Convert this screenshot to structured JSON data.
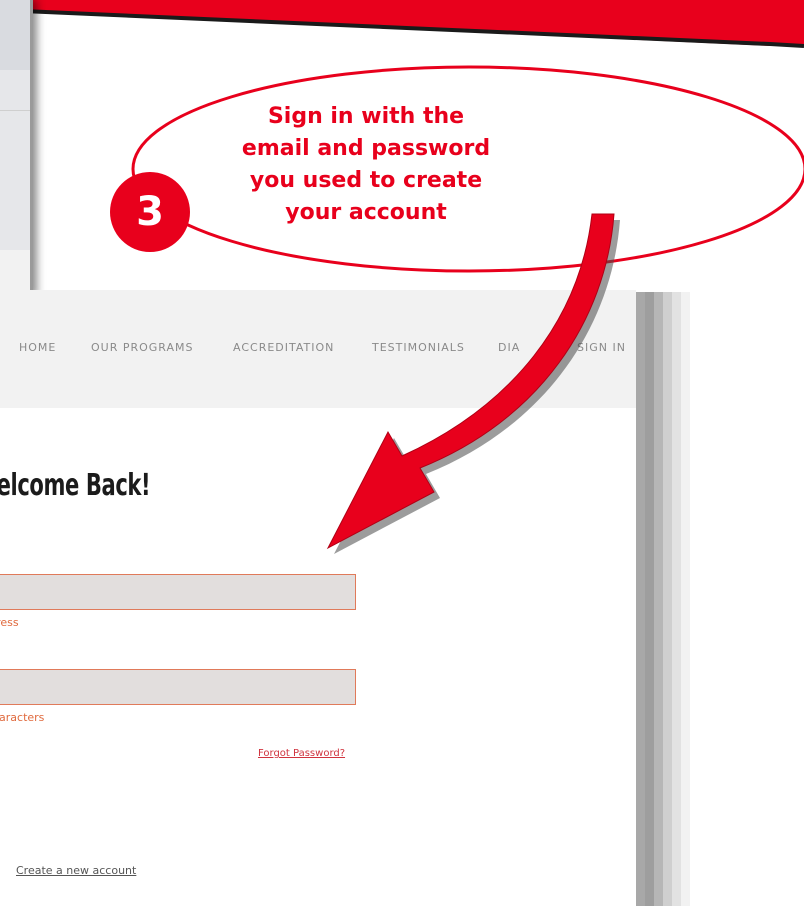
{
  "callout": {
    "text": "Sign in with the email and password you used to create your account",
    "step_number": "3",
    "accent_color": "#e8001c"
  },
  "site": {
    "nav": {
      "items": [
        "HOME",
        "OUR PROGRAMS",
        "ACCREDITATION",
        "TESTIMONIALS",
        "DIA",
        "SIGN IN"
      ]
    },
    "heading": "Velcome Back!",
    "email_field": {
      "value": "",
      "hint": "ldress"
    },
    "password_field": {
      "value": "",
      "hint": "characters"
    },
    "forgot_password": "Forgot Password?",
    "create_account": "Create a new account"
  }
}
